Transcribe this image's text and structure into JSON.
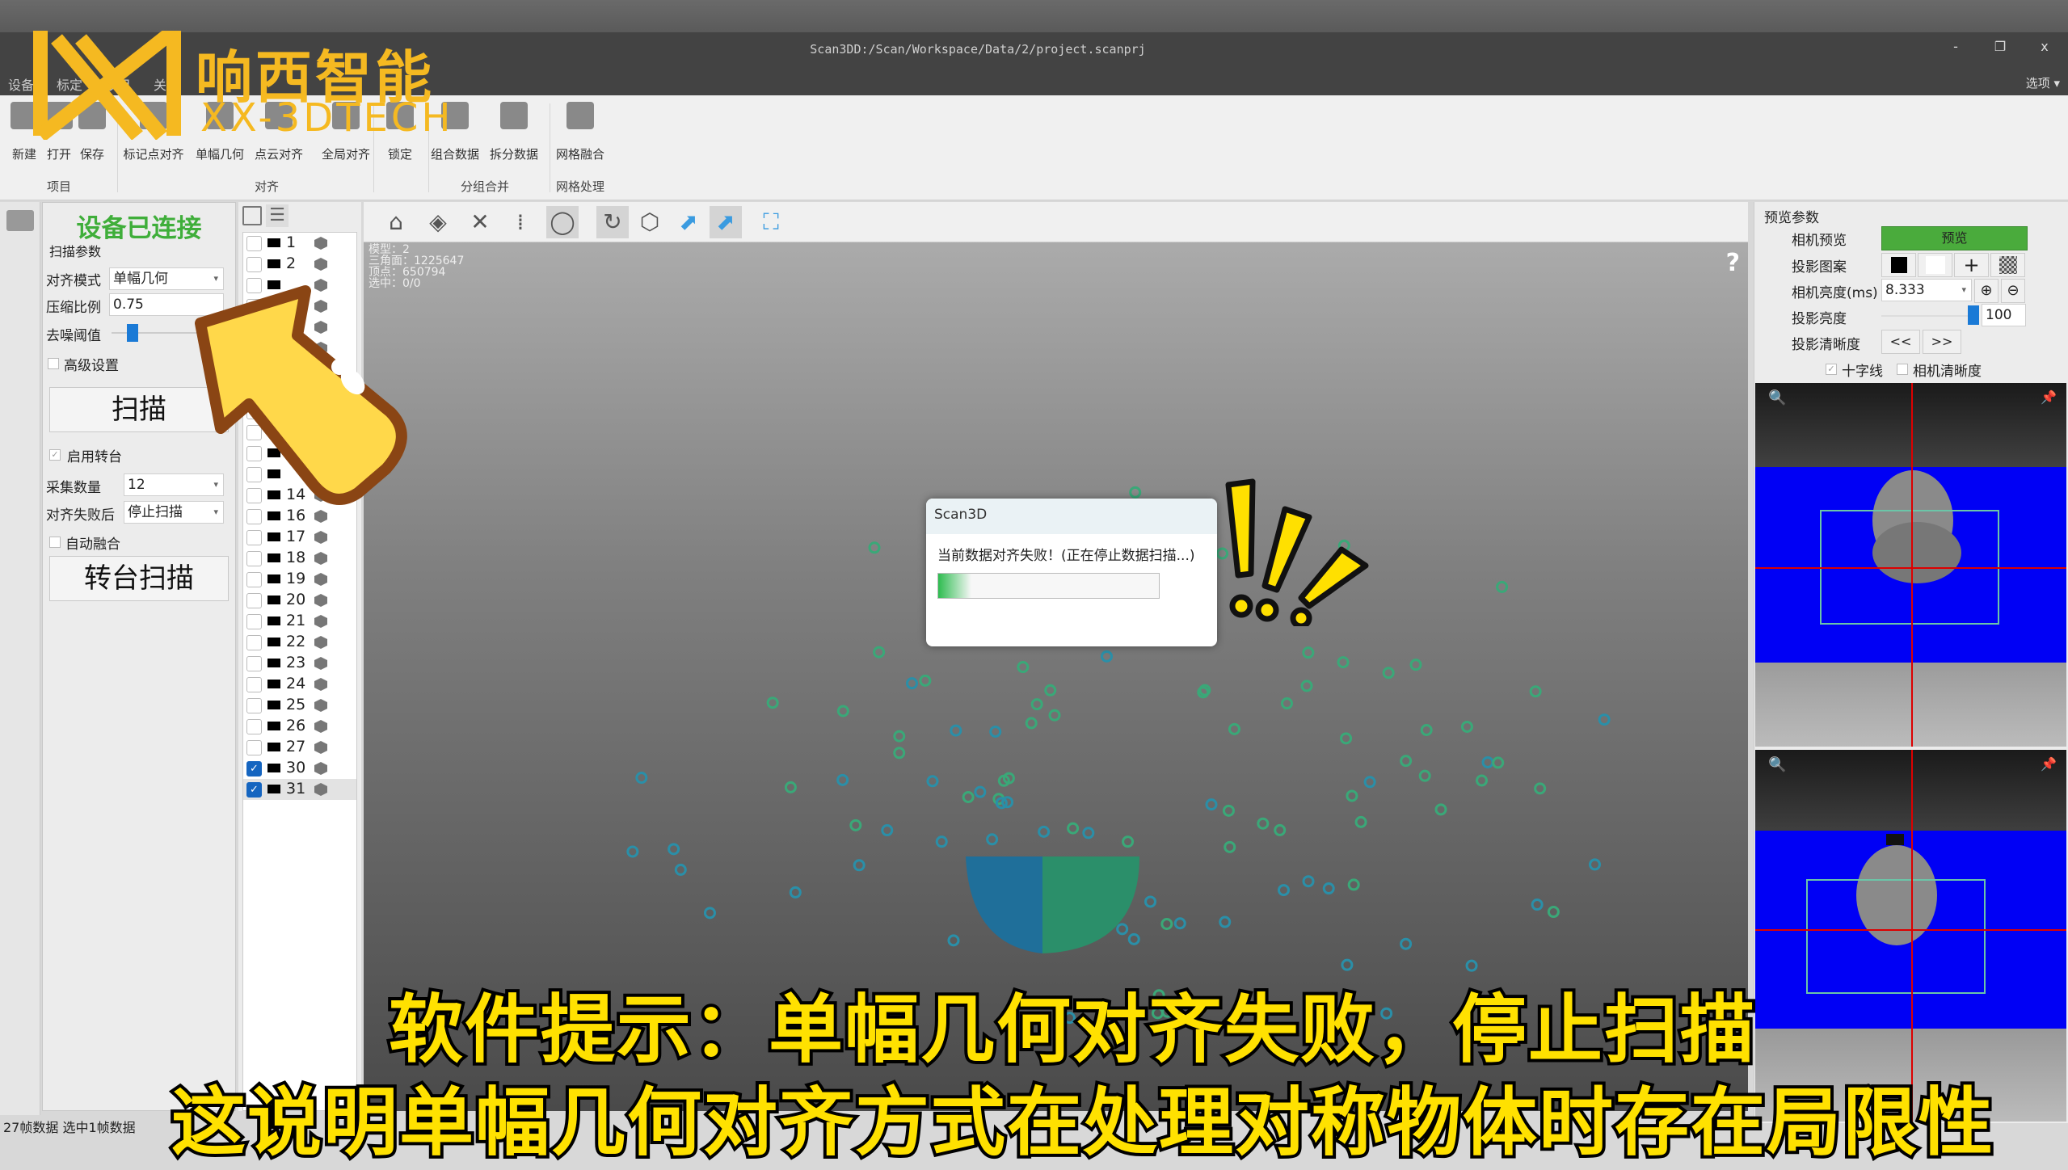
{
  "window": {
    "title": "Scan3DD:/Scan/Workspace/Data/2/project.scanprj",
    "minimize": "-",
    "restore": "❐",
    "close": "x",
    "options": "选项 ▾",
    "menus": [
      "设备",
      "标定",
      "项目",
      "关于"
    ]
  },
  "ribbon": {
    "buttons": [
      {
        "label": "新建"
      },
      {
        "label": "打开"
      },
      {
        "label": "保存"
      },
      {
        "label": "标记点对齐"
      },
      {
        "label": "单幅几何"
      },
      {
        "label": "点云对齐"
      },
      {
        "label": "全局对齐"
      },
      {
        "label": "锁定"
      },
      {
        "label": "组合数据"
      },
      {
        "label": "拆分数据"
      },
      {
        "label": "网格融合"
      }
    ],
    "groups": [
      "项目",
      "对齐",
      "分组合并",
      "网格处理"
    ]
  },
  "left": {
    "status": "设备已连接",
    "status_color": "#3fae3a",
    "scan_params": "扫描参数",
    "align_mode_label": "对齐模式",
    "align_mode": "单幅几何",
    "compress_label": "压缩比例",
    "compress": "0.75",
    "denoise_label": "去噪阈值",
    "denoise_level": 0.0,
    "advanced": "高级设置",
    "scan_button": "扫描",
    "turntable": "启用转台",
    "turntable_checked": true,
    "count_label": "采集数量",
    "count": "12",
    "fail_label": "对齐失败后",
    "fail_action": "停止扫描",
    "auto_fuse": "自动融合",
    "auto_fuse_checked": false,
    "turntable_scan_button": "转台扫描"
  },
  "frames": [
    {
      "n": "1",
      "checked": false
    },
    {
      "n": "2",
      "checked": false
    },
    {
      "n": "",
      "checked": false
    },
    {
      "n": "",
      "checked": false
    },
    {
      "n": "",
      "checked": false
    },
    {
      "n": "",
      "checked": false
    },
    {
      "n": "",
      "checked": false
    },
    {
      "n": "",
      "checked": false
    },
    {
      "n": "",
      "checked": false
    },
    {
      "n": "",
      "checked": false
    },
    {
      "n": "",
      "checked": false
    },
    {
      "n": "",
      "checked": false
    },
    {
      "n": "14",
      "checked": false
    },
    {
      "n": "16",
      "checked": false
    },
    {
      "n": "17",
      "checked": false
    },
    {
      "n": "18",
      "checked": false
    },
    {
      "n": "19",
      "checked": false
    },
    {
      "n": "20",
      "checked": false
    },
    {
      "n": "21",
      "checked": false
    },
    {
      "n": "22",
      "checked": false
    },
    {
      "n": "23",
      "checked": false
    },
    {
      "n": "24",
      "checked": false
    },
    {
      "n": "25",
      "checked": false
    },
    {
      "n": "26",
      "checked": false
    },
    {
      "n": "27",
      "checked": false
    },
    {
      "n": "30",
      "checked": true
    },
    {
      "n": "31",
      "checked": true,
      "selected": true
    }
  ],
  "viewport": {
    "info": [
      "模型：2",
      "三角面：1225647",
      "顶点：650794",
      "选中：0/0"
    ],
    "help": "?",
    "tools": [
      "home-icon",
      "grid-plane-icon",
      "measure-icon",
      "point-filter-icon",
      "ring-icon",
      "rotate-select-icon",
      "polygon-select-icon",
      "plane-up-icon",
      "planes-up-icon",
      "fit-view-icon"
    ]
  },
  "dialog": {
    "title": "Scan3D",
    "message": "当前数据对齐失败！(正在停止数据扫描...)",
    "progress": 0.15
  },
  "right": {
    "title": "预览参数",
    "camera_preview_label": "相机预览",
    "preview_button": "预览",
    "preview_color": "#4aab3c",
    "pattern_label": "投影图案",
    "exposure_label": "相机亮度(ms)",
    "exposure": "8.333",
    "proj_brightness_label": "投影亮度",
    "proj_brightness": "100",
    "sharpness_label": "投影清晰度",
    "prev": "<<",
    "next": ">>",
    "crosshair": "十字线",
    "crosshair_checked": true,
    "cam_sharpness": "相机清晰度",
    "cam_sharpness_checked": false
  },
  "status_bar": "27帧数据 选中1帧数据",
  "subtitles": [
    "软件提示：单幅几何对齐失败，停止扫描",
    "这说明单幅几何对齐方式在处理对称物体时存在局限性"
  ],
  "watermark": {
    "name": "响西智能",
    "sub": "XX-3DTECH"
  }
}
